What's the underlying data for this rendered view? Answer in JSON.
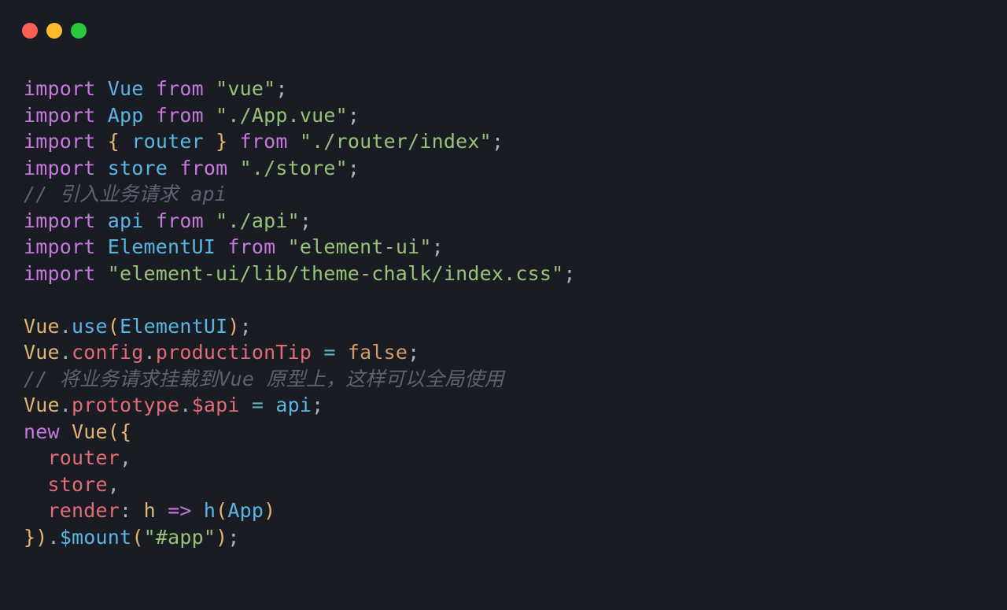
{
  "titlebar": {
    "red": "close-window",
    "yellow": "minimize-window",
    "green": "maximize-window"
  },
  "code": {
    "kw_import": "import",
    "kw_from": "from",
    "kw_new": "new",
    "id_Vue": "Vue",
    "id_App": "App",
    "id_router": "router",
    "id_store": "store",
    "id_api": "api",
    "id_ElementUI": "ElementUI",
    "str_vue": "\"vue\"",
    "str_Appvue": "\"./App.vue\"",
    "str_routerindex": "\"./router/index\"",
    "str_store": "\"./store\"",
    "str_api": "\"./api\"",
    "str_elementui": "\"element-ui\"",
    "str_elementui_css": "\"element-ui/lib/theme-chalk/index.css\"",
    "str_app_mount": "\"#app\"",
    "cm1": "// 引入业务请求 api",
    "cm2": "// 将业务请求挂载到Vue 原型上，这样可以全局使用",
    "fn_use": "use",
    "prop_config": "config",
    "prop_productionTip": "productionTip",
    "prop_prototype": "prototype",
    "prop_dapi": "$api",
    "cnst_false": "false",
    "propkey_router": "router",
    "propkey_store": "store",
    "propkey_render": "render",
    "var_h": "h",
    "var_h2": "h",
    "id_App2": "App",
    "fn_mount": "$mount",
    "op_eq1": "=",
    "op_eq2": "=",
    "op_arrow": "=>",
    "semi": ";",
    "comma": ",",
    "dot": ".",
    "space": " ",
    "lbrace": "{",
    "rbrace": "}",
    "lparen": "(",
    "rparen": ")",
    "colon": ":",
    "indent": "  "
  }
}
